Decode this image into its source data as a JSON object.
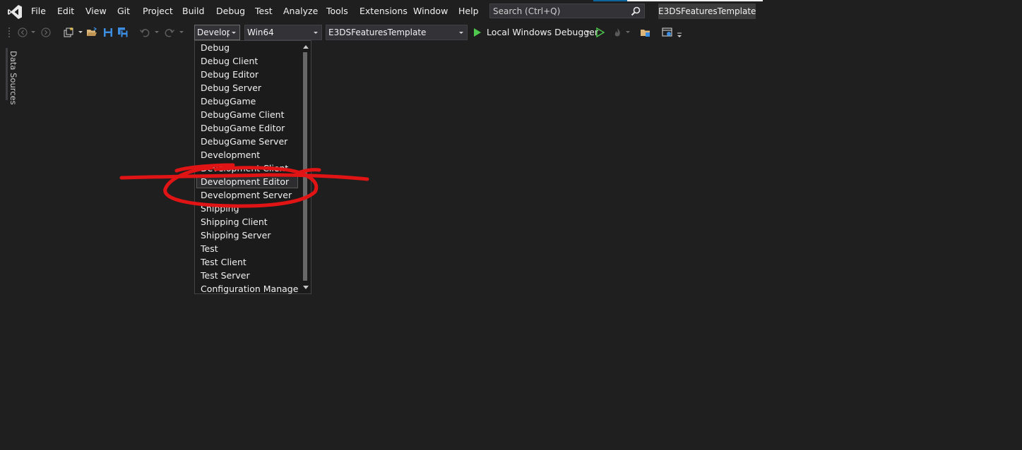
{
  "menubar": {
    "items": [
      "File",
      "Edit",
      "View",
      "Git",
      "Project",
      "Build",
      "Debug",
      "Test",
      "Analyze",
      "Tools",
      "Extensions",
      "Window",
      "Help"
    ],
    "search_placeholder": "Search (Ctrl+Q)",
    "solution_title": "E3DSFeaturesTemplate"
  },
  "toolbar": {
    "configuration": "Development Editor",
    "platform": "Win64",
    "startup_project": "E3DSFeaturesTemplate",
    "debugger": "Local Windows Debugger"
  },
  "side_panel": {
    "label": "Data Sources"
  },
  "dropdown": {
    "items": [
      "Debug",
      "Debug Client",
      "Debug Editor",
      "Debug Server",
      "DebugGame",
      "DebugGame Client",
      "DebugGame Editor",
      "DebugGame Server",
      "Development",
      "Development Client",
      "Development Editor",
      "Development Server",
      "Shipping",
      "Shipping Client",
      "Shipping Server",
      "Test",
      "Test Client",
      "Test Server",
      "Configuration Manager..."
    ],
    "highlighted": "Development Editor"
  },
  "colors": {
    "background": "#1f1f1f",
    "accent_green": "#4ec94e",
    "accent_blue": "#3c8ee0",
    "annotation_red": "#e01414"
  }
}
